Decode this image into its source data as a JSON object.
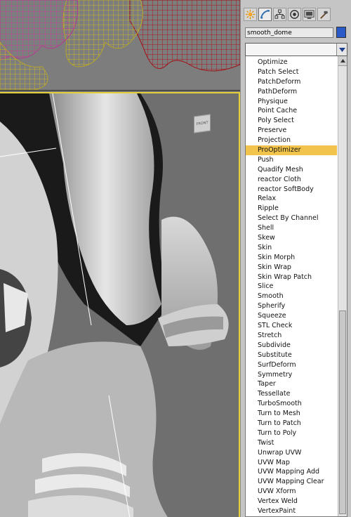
{
  "command_panel": {
    "object_name": "smooth_dome",
    "object_color": "#2a59c8",
    "tabs": [
      "create-icon",
      "modify-icon",
      "hierarchy-icon",
      "motion-icon",
      "display-icon",
      "utilities-icon"
    ],
    "modifier_dropdown_value": ""
  },
  "viewport": {
    "viewcube_label": "FRONT",
    "active_border_color": "#e8d23a"
  },
  "modifier_list": {
    "selected": "ProOptimizer",
    "items": [
      "Optimize",
      "Patch Select",
      "PatchDeform",
      "PathDeform",
      "Physique",
      "Point Cache",
      "Poly Select",
      "Preserve",
      "Projection",
      "ProOptimizer",
      "Push",
      "Quadify Mesh",
      "reactor Cloth",
      "reactor SoftBody",
      "Relax",
      "Ripple",
      "Select By Channel",
      "Shell",
      "Skew",
      "Skin",
      "Skin Morph",
      "Skin Wrap",
      "Skin Wrap Patch",
      "Slice",
      "Smooth",
      "Spherify",
      "Squeeze",
      "STL Check",
      "Stretch",
      "Subdivide",
      "Substitute",
      "SurfDeform",
      "Symmetry",
      "Taper",
      "Tessellate",
      "TurboSmooth",
      "Turn to Mesh",
      "Turn to Patch",
      "Turn to Poly",
      "Twist",
      "Unwrap UVW",
      "UVW Map",
      "UVW Mapping Add",
      "UVW Mapping Clear",
      "UVW Xform",
      "Vertex Weld",
      "VertexPaint"
    ]
  }
}
